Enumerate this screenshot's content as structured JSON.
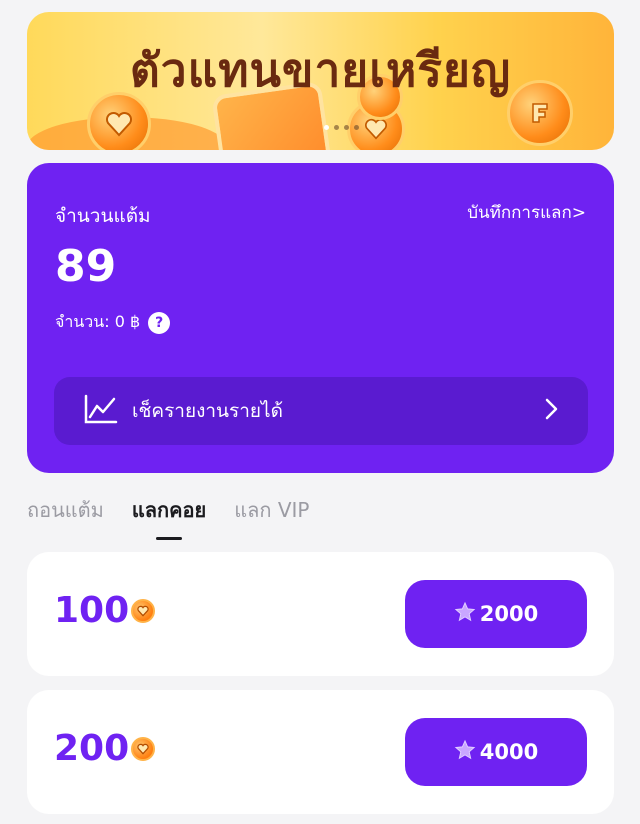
{
  "banner": {
    "title": "ตัวแทนขายเหรียญ",
    "carousel_active_index": 0,
    "carousel_count": 4
  },
  "points_card": {
    "label": "จำนวนแต้ม",
    "history_link": "บันทึกการแลก>",
    "points": "89",
    "amount_label": "จำนวน: 0 ฿",
    "help_icon": "?",
    "report_button": "เช็ครายงานรายได้"
  },
  "tabs": [
    {
      "label": "ถอนแต้ม",
      "active": false
    },
    {
      "label": "แลกคอย",
      "active": true
    },
    {
      "label": "แลก VIP",
      "active": false
    }
  ],
  "exchange_items": [
    {
      "coins": "100",
      "price": "2000"
    },
    {
      "coins": "200",
      "price": "4000"
    }
  ],
  "colors": {
    "accent": "#6f22f2",
    "accent_dark": "#5a1bd0",
    "background": "#f4f4f6",
    "coin": "#ff8c1a"
  },
  "icons": {
    "chart": "line-chart-icon",
    "chevron": "chevron-right-icon",
    "star": "star-icon",
    "coin": "heart-coin-icon"
  }
}
